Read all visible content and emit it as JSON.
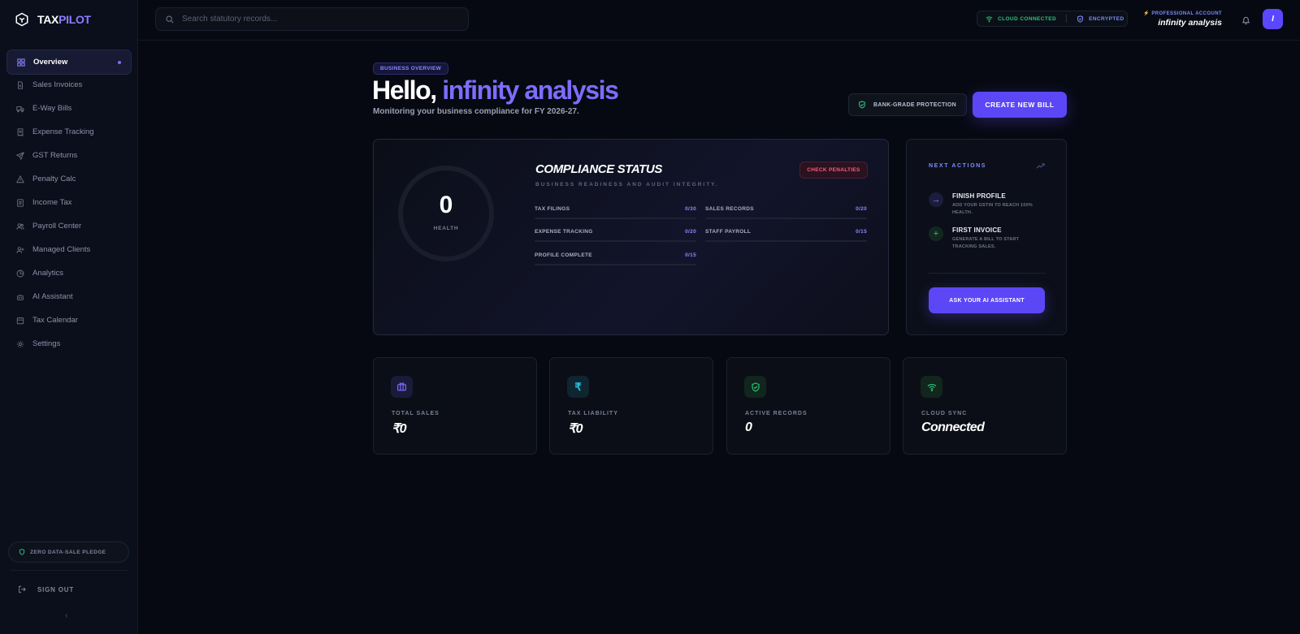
{
  "app": {
    "brand_prefix": "TAX",
    "brand_suffix": "PILOT",
    "accent_color": "#5b47f5"
  },
  "sidebar": {
    "items": [
      {
        "label": "Overview",
        "icon": "grid-icon",
        "active": true
      },
      {
        "label": "Sales Invoices",
        "icon": "file-icon"
      },
      {
        "label": "E-Way Bills",
        "icon": "truck-icon"
      },
      {
        "label": "Expense Tracking",
        "icon": "receipt-icon"
      },
      {
        "label": "GST Returns",
        "icon": "send-icon"
      },
      {
        "label": "Penalty Calc",
        "icon": "warning-icon"
      },
      {
        "label": "Income Tax",
        "icon": "document-icon"
      },
      {
        "label": "Payroll Center",
        "icon": "users-icon"
      },
      {
        "label": "Managed Clients",
        "icon": "user-plus-icon"
      },
      {
        "label": "Analytics",
        "icon": "pie-chart-icon"
      },
      {
        "label": "AI Assistant",
        "icon": "bot-icon"
      },
      {
        "label": "Tax Calendar",
        "icon": "calendar-icon"
      },
      {
        "label": "Settings",
        "icon": "gear-icon"
      }
    ],
    "pledge": "ZERO DATA-SALE PLEDGE",
    "signout": "SIGN OUT"
  },
  "header": {
    "search_placeholder": "Search statutory records...",
    "cloud_status": "CLOUD CONNECTED",
    "encryption_status": "ENCRYPTED",
    "account_label": "PROFESSIONAL ACCOUNT",
    "account_name": "infinity analysis",
    "avatar_initial": "I"
  },
  "main": {
    "badge": "BUSINESS OVERVIEW",
    "greeting": "Hello,",
    "user_name": "infinity analysis",
    "subtitle": "Monitoring your business compliance for FY 2026-27.",
    "protection_label": "BANK-GRADE PROTECTION",
    "create_bill_label": "CREATE NEW BILL"
  },
  "compliance": {
    "health_value": "0",
    "health_label": "HEALTH",
    "health_fraction": 0,
    "title": "COMPLIANCE STATUS",
    "subtitle": "BUSINESS READINESS AND AUDIT INTEGRITY.",
    "penalty_button": "CHECK PENALTIES",
    "metrics": [
      {
        "label": "TAX FILINGS",
        "value": "0/30",
        "fraction": 0
      },
      {
        "label": "SALES RECORDS",
        "value": "0/20",
        "fraction": 0
      },
      {
        "label": "EXPENSE TRACKING",
        "value": "0/20",
        "fraction": 0
      },
      {
        "label": "STAFF PAYROLL",
        "value": "0/15",
        "fraction": 0
      },
      {
        "label": "PROFILE COMPLETE",
        "value": "0/15",
        "fraction": 0
      }
    ]
  },
  "next_actions": {
    "title": "NEXT ACTIONS",
    "items": [
      {
        "title": "FINISH PROFILE",
        "desc": "ADD YOUR GSTIN TO REACH 100% HEALTH."
      },
      {
        "title": "FIRST INVOICE",
        "desc": "GENERATE A BILL TO START TRACKING SALES."
      }
    ],
    "ai_button": "ASK YOUR AI ASSISTANT"
  },
  "stats": [
    {
      "label": "TOTAL SALES",
      "value": "₹0",
      "icon": "briefcase-icon",
      "color": "#7c6dff"
    },
    {
      "label": "TAX LIABILITY",
      "value": "₹0",
      "icon": "rupee-icon",
      "color": "#22c7e8"
    },
    {
      "label": "ACTIVE RECORDS",
      "value": "0",
      "icon": "shield-check-icon",
      "color": "#2ec27e"
    },
    {
      "label": "CLOUD SYNC",
      "value": "Connected",
      "icon": "wifi-icon",
      "color": "#2ec27e"
    }
  ]
}
